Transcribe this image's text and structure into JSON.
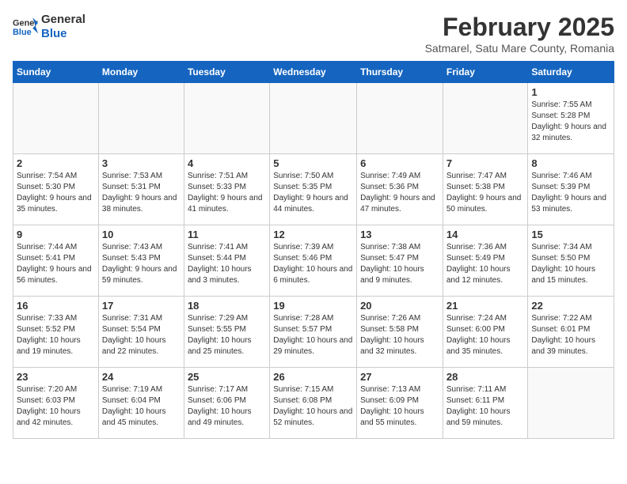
{
  "header": {
    "logo_general": "General",
    "logo_blue": "Blue",
    "title": "February 2025",
    "subtitle": "Satmarel, Satu Mare County, Romania"
  },
  "days_of_week": [
    "Sunday",
    "Monday",
    "Tuesday",
    "Wednesday",
    "Thursday",
    "Friday",
    "Saturday"
  ],
  "weeks": [
    [
      {
        "day": "",
        "info": ""
      },
      {
        "day": "",
        "info": ""
      },
      {
        "day": "",
        "info": ""
      },
      {
        "day": "",
        "info": ""
      },
      {
        "day": "",
        "info": ""
      },
      {
        "day": "",
        "info": ""
      },
      {
        "day": "1",
        "info": "Sunrise: 7:55 AM\nSunset: 5:28 PM\nDaylight: 9 hours and 32 minutes."
      }
    ],
    [
      {
        "day": "2",
        "info": "Sunrise: 7:54 AM\nSunset: 5:30 PM\nDaylight: 9 hours and 35 minutes."
      },
      {
        "day": "3",
        "info": "Sunrise: 7:53 AM\nSunset: 5:31 PM\nDaylight: 9 hours and 38 minutes."
      },
      {
        "day": "4",
        "info": "Sunrise: 7:51 AM\nSunset: 5:33 PM\nDaylight: 9 hours and 41 minutes."
      },
      {
        "day": "5",
        "info": "Sunrise: 7:50 AM\nSunset: 5:35 PM\nDaylight: 9 hours and 44 minutes."
      },
      {
        "day": "6",
        "info": "Sunrise: 7:49 AM\nSunset: 5:36 PM\nDaylight: 9 hours and 47 minutes."
      },
      {
        "day": "7",
        "info": "Sunrise: 7:47 AM\nSunset: 5:38 PM\nDaylight: 9 hours and 50 minutes."
      },
      {
        "day": "8",
        "info": "Sunrise: 7:46 AM\nSunset: 5:39 PM\nDaylight: 9 hours and 53 minutes."
      }
    ],
    [
      {
        "day": "9",
        "info": "Sunrise: 7:44 AM\nSunset: 5:41 PM\nDaylight: 9 hours and 56 minutes."
      },
      {
        "day": "10",
        "info": "Sunrise: 7:43 AM\nSunset: 5:43 PM\nDaylight: 9 hours and 59 minutes."
      },
      {
        "day": "11",
        "info": "Sunrise: 7:41 AM\nSunset: 5:44 PM\nDaylight: 10 hours and 3 minutes."
      },
      {
        "day": "12",
        "info": "Sunrise: 7:39 AM\nSunset: 5:46 PM\nDaylight: 10 hours and 6 minutes."
      },
      {
        "day": "13",
        "info": "Sunrise: 7:38 AM\nSunset: 5:47 PM\nDaylight: 10 hours and 9 minutes."
      },
      {
        "day": "14",
        "info": "Sunrise: 7:36 AM\nSunset: 5:49 PM\nDaylight: 10 hours and 12 minutes."
      },
      {
        "day": "15",
        "info": "Sunrise: 7:34 AM\nSunset: 5:50 PM\nDaylight: 10 hours and 15 minutes."
      }
    ],
    [
      {
        "day": "16",
        "info": "Sunrise: 7:33 AM\nSunset: 5:52 PM\nDaylight: 10 hours and 19 minutes."
      },
      {
        "day": "17",
        "info": "Sunrise: 7:31 AM\nSunset: 5:54 PM\nDaylight: 10 hours and 22 minutes."
      },
      {
        "day": "18",
        "info": "Sunrise: 7:29 AM\nSunset: 5:55 PM\nDaylight: 10 hours and 25 minutes."
      },
      {
        "day": "19",
        "info": "Sunrise: 7:28 AM\nSunset: 5:57 PM\nDaylight: 10 hours and 29 minutes."
      },
      {
        "day": "20",
        "info": "Sunrise: 7:26 AM\nSunset: 5:58 PM\nDaylight: 10 hours and 32 minutes."
      },
      {
        "day": "21",
        "info": "Sunrise: 7:24 AM\nSunset: 6:00 PM\nDaylight: 10 hours and 35 minutes."
      },
      {
        "day": "22",
        "info": "Sunrise: 7:22 AM\nSunset: 6:01 PM\nDaylight: 10 hours and 39 minutes."
      }
    ],
    [
      {
        "day": "23",
        "info": "Sunrise: 7:20 AM\nSunset: 6:03 PM\nDaylight: 10 hours and 42 minutes."
      },
      {
        "day": "24",
        "info": "Sunrise: 7:19 AM\nSunset: 6:04 PM\nDaylight: 10 hours and 45 minutes."
      },
      {
        "day": "25",
        "info": "Sunrise: 7:17 AM\nSunset: 6:06 PM\nDaylight: 10 hours and 49 minutes."
      },
      {
        "day": "26",
        "info": "Sunrise: 7:15 AM\nSunset: 6:08 PM\nDaylight: 10 hours and 52 minutes."
      },
      {
        "day": "27",
        "info": "Sunrise: 7:13 AM\nSunset: 6:09 PM\nDaylight: 10 hours and 55 minutes."
      },
      {
        "day": "28",
        "info": "Sunrise: 7:11 AM\nSunset: 6:11 PM\nDaylight: 10 hours and 59 minutes."
      },
      {
        "day": "",
        "info": ""
      }
    ]
  ]
}
